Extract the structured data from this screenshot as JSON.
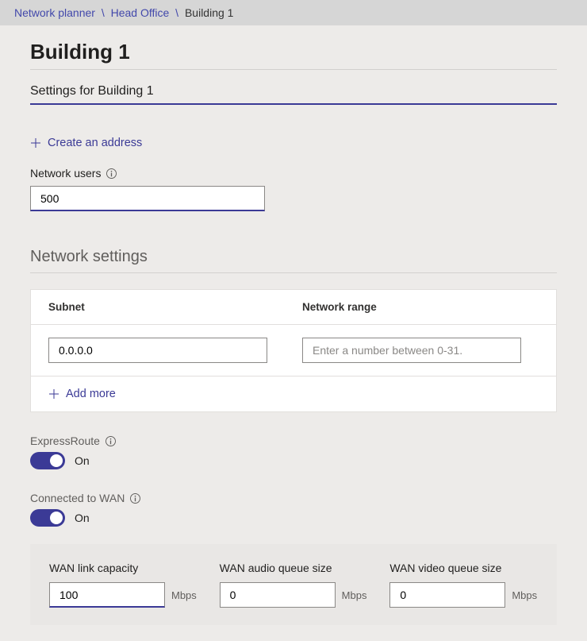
{
  "breadcrumb": {
    "root": "Network planner",
    "parent": "Head Office",
    "current": "Building 1"
  },
  "pageTitle": "Building 1",
  "settingsName": "Settings for Building 1",
  "createAddress": "Create an address",
  "networkUsers": {
    "label": "Network users",
    "value": "500"
  },
  "networkSettings": {
    "title": "Network settings",
    "subnetHeader": "Subnet",
    "rangeHeader": "Network range",
    "subnetValue": "0.0.0.0",
    "rangePlaceholder": "Enter a number between 0-31.",
    "addMore": "Add more"
  },
  "expressRoute": {
    "label": "ExpressRoute",
    "state": "On"
  },
  "connectedWan": {
    "label": "Connected to WAN",
    "state": "On"
  },
  "wan": {
    "linkCapacity": {
      "label": "WAN link capacity",
      "value": "100",
      "unit": "Mbps"
    },
    "audioQueue": {
      "label": "WAN audio queue size",
      "value": "0",
      "unit": "Mbps"
    },
    "videoQueue": {
      "label": "WAN video queue size",
      "value": "0",
      "unit": "Mbps"
    }
  }
}
